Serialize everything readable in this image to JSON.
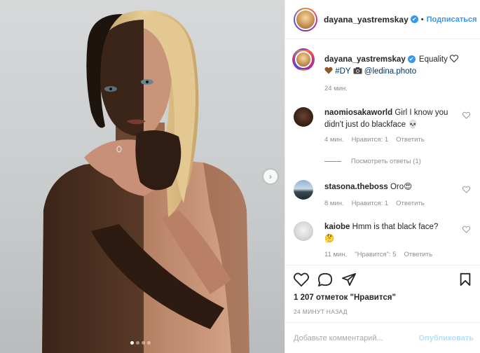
{
  "post": {
    "media": {
      "next_icon": "chevron-right-icon",
      "carousel_dots": [
        true,
        false,
        false,
        false
      ]
    },
    "header": {
      "username": "dayana_yastremskay",
      "verified": "✔",
      "bullet": "•",
      "follow_label": "Подписаться"
    },
    "caption": {
      "username": "dayana_yastremskay",
      "text_before": " Equality",
      "hashtag": "#DY",
      "mention": "@ledina.photo",
      "time": "24 мин."
    },
    "comments": [
      {
        "username": "naomiosakaworld",
        "text": " Girl I know you didn't just do blackface 💀",
        "time": "4 мин.",
        "likes": "Нравится: 1",
        "reply": "Ответить"
      },
      {
        "username": "stasona.theboss",
        "text": " Oro😍",
        "time": "8 мин.",
        "likes": "Нравится: 1",
        "reply": "Ответить"
      },
      {
        "username": "kaiobe",
        "text": " Hmm is that black face? 🤔",
        "time": "11 мин.",
        "likes": "\"Нравится\": 5",
        "reply": "Ответить"
      }
    ],
    "view_replies": "Посмотреть ответы (1)",
    "likes_count": "1 207 отметок \"Нравится\"",
    "timestamp": "24 МИНУТ НАЗАД",
    "comment_placeholder": "Добавьте комментарий...",
    "publish_label": "Опубликовать",
    "colors": {
      "accent": "#3897f0",
      "publish_disabled": "#b2dffc",
      "text": "#262626",
      "muted": "#8e8e8e"
    }
  }
}
